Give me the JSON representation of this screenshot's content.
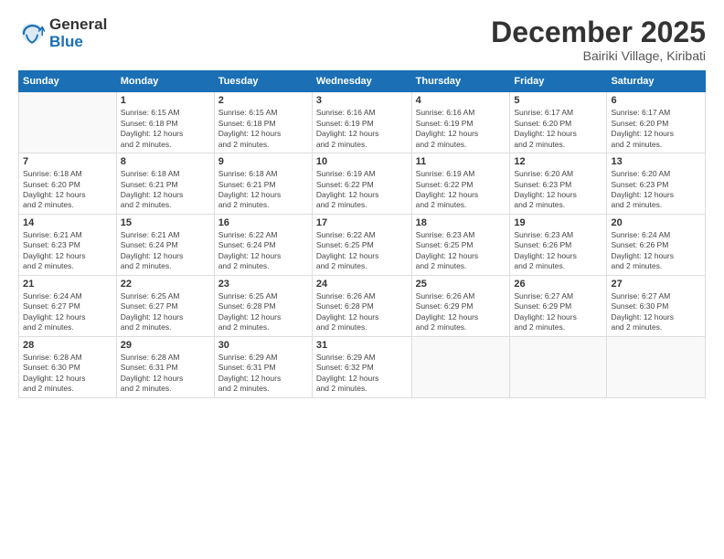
{
  "logo": {
    "general": "General",
    "blue": "Blue"
  },
  "title": "December 2025",
  "subtitle": "Bairiki Village, Kiribati",
  "days_of_week": [
    "Sunday",
    "Monday",
    "Tuesday",
    "Wednesday",
    "Thursday",
    "Friday",
    "Saturday"
  ],
  "weeks": [
    [
      {
        "day": "",
        "info": ""
      },
      {
        "day": "1",
        "info": "Sunrise: 6:15 AM\nSunset: 6:18 PM\nDaylight: 12 hours\nand 2 minutes."
      },
      {
        "day": "2",
        "info": "Sunrise: 6:15 AM\nSunset: 6:18 PM\nDaylight: 12 hours\nand 2 minutes."
      },
      {
        "day": "3",
        "info": "Sunrise: 6:16 AM\nSunset: 6:19 PM\nDaylight: 12 hours\nand 2 minutes."
      },
      {
        "day": "4",
        "info": "Sunrise: 6:16 AM\nSunset: 6:19 PM\nDaylight: 12 hours\nand 2 minutes."
      },
      {
        "day": "5",
        "info": "Sunrise: 6:17 AM\nSunset: 6:20 PM\nDaylight: 12 hours\nand 2 minutes."
      },
      {
        "day": "6",
        "info": "Sunrise: 6:17 AM\nSunset: 6:20 PM\nDaylight: 12 hours\nand 2 minutes."
      }
    ],
    [
      {
        "day": "7",
        "info": "Sunrise: 6:18 AM\nSunset: 6:20 PM\nDaylight: 12 hours\nand 2 minutes."
      },
      {
        "day": "8",
        "info": "Sunrise: 6:18 AM\nSunset: 6:21 PM\nDaylight: 12 hours\nand 2 minutes."
      },
      {
        "day": "9",
        "info": "Sunrise: 6:18 AM\nSunset: 6:21 PM\nDaylight: 12 hours\nand 2 minutes."
      },
      {
        "day": "10",
        "info": "Sunrise: 6:19 AM\nSunset: 6:22 PM\nDaylight: 12 hours\nand 2 minutes."
      },
      {
        "day": "11",
        "info": "Sunrise: 6:19 AM\nSunset: 6:22 PM\nDaylight: 12 hours\nand 2 minutes."
      },
      {
        "day": "12",
        "info": "Sunrise: 6:20 AM\nSunset: 6:23 PM\nDaylight: 12 hours\nand 2 minutes."
      },
      {
        "day": "13",
        "info": "Sunrise: 6:20 AM\nSunset: 6:23 PM\nDaylight: 12 hours\nand 2 minutes."
      }
    ],
    [
      {
        "day": "14",
        "info": "Sunrise: 6:21 AM\nSunset: 6:23 PM\nDaylight: 12 hours\nand 2 minutes."
      },
      {
        "day": "15",
        "info": "Sunrise: 6:21 AM\nSunset: 6:24 PM\nDaylight: 12 hours\nand 2 minutes."
      },
      {
        "day": "16",
        "info": "Sunrise: 6:22 AM\nSunset: 6:24 PM\nDaylight: 12 hours\nand 2 minutes."
      },
      {
        "day": "17",
        "info": "Sunrise: 6:22 AM\nSunset: 6:25 PM\nDaylight: 12 hours\nand 2 minutes."
      },
      {
        "day": "18",
        "info": "Sunrise: 6:23 AM\nSunset: 6:25 PM\nDaylight: 12 hours\nand 2 minutes."
      },
      {
        "day": "19",
        "info": "Sunrise: 6:23 AM\nSunset: 6:26 PM\nDaylight: 12 hours\nand 2 minutes."
      },
      {
        "day": "20",
        "info": "Sunrise: 6:24 AM\nSunset: 6:26 PM\nDaylight: 12 hours\nand 2 minutes."
      }
    ],
    [
      {
        "day": "21",
        "info": "Sunrise: 6:24 AM\nSunset: 6:27 PM\nDaylight: 12 hours\nand 2 minutes."
      },
      {
        "day": "22",
        "info": "Sunrise: 6:25 AM\nSunset: 6:27 PM\nDaylight: 12 hours\nand 2 minutes."
      },
      {
        "day": "23",
        "info": "Sunrise: 6:25 AM\nSunset: 6:28 PM\nDaylight: 12 hours\nand 2 minutes."
      },
      {
        "day": "24",
        "info": "Sunrise: 6:26 AM\nSunset: 6:28 PM\nDaylight: 12 hours\nand 2 minutes."
      },
      {
        "day": "25",
        "info": "Sunrise: 6:26 AM\nSunset: 6:29 PM\nDaylight: 12 hours\nand 2 minutes."
      },
      {
        "day": "26",
        "info": "Sunrise: 6:27 AM\nSunset: 6:29 PM\nDaylight: 12 hours\nand 2 minutes."
      },
      {
        "day": "27",
        "info": "Sunrise: 6:27 AM\nSunset: 6:30 PM\nDaylight: 12 hours\nand 2 minutes."
      }
    ],
    [
      {
        "day": "28",
        "info": "Sunrise: 6:28 AM\nSunset: 6:30 PM\nDaylight: 12 hours\nand 2 minutes."
      },
      {
        "day": "29",
        "info": "Sunrise: 6:28 AM\nSunset: 6:31 PM\nDaylight: 12 hours\nand 2 minutes."
      },
      {
        "day": "30",
        "info": "Sunrise: 6:29 AM\nSunset: 6:31 PM\nDaylight: 12 hours\nand 2 minutes."
      },
      {
        "day": "31",
        "info": "Sunrise: 6:29 AM\nSunset: 6:32 PM\nDaylight: 12 hours\nand 2 minutes."
      },
      {
        "day": "",
        "info": ""
      },
      {
        "day": "",
        "info": ""
      },
      {
        "day": "",
        "info": ""
      }
    ]
  ]
}
